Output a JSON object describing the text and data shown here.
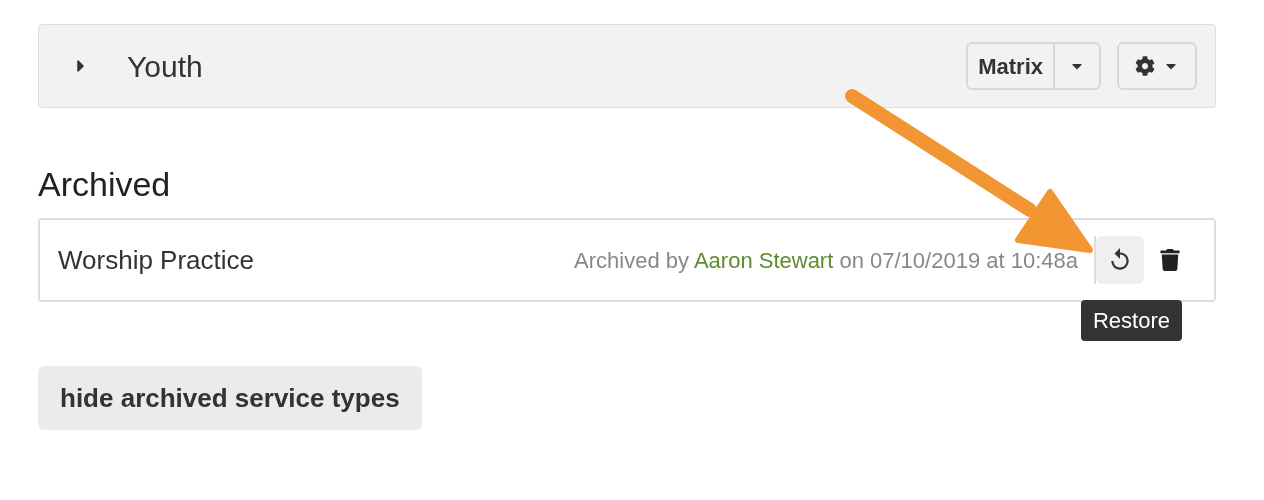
{
  "service_type": {
    "name": "Youth",
    "expanded": false,
    "view_button": "Matrix"
  },
  "archived_section": {
    "heading": "Archived",
    "items": [
      {
        "name": "Worship Practice",
        "archived_prefix": "Archived by",
        "archived_by": "Aaron Stewart",
        "archived_suffix": "on 07/10/2019 at 10:48a",
        "tooltip": "Restore"
      }
    ]
  },
  "toggle_button": "hide archived service types"
}
